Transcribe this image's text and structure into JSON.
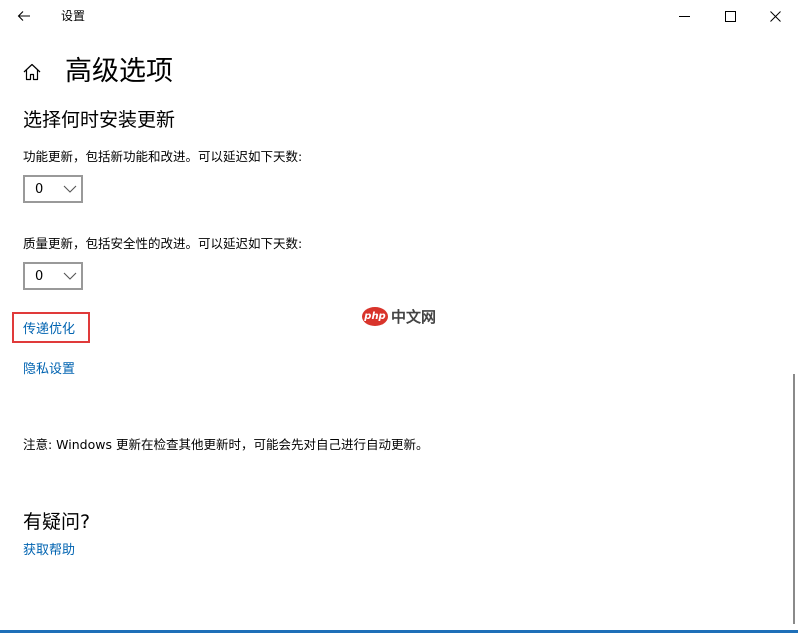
{
  "titlebar": {
    "app_title": "设置"
  },
  "header": {
    "title": "高级选项"
  },
  "install_section": {
    "title": "选择何时安装更新",
    "feature_updates": {
      "label": "功能更新，包括新功能和改进。可以延迟如下天数:",
      "value": "0"
    },
    "quality_updates": {
      "label": "质量更新，包括安全性的改进。可以延迟如下天数:",
      "value": "0"
    }
  },
  "links": {
    "delivery_optimization": "传递优化",
    "privacy_settings": "隐私设置"
  },
  "watermark": {
    "badge": "php",
    "text": "中文网"
  },
  "note": "注意: Windows 更新在检查其他更新时，可能会先对自己进行自动更新。",
  "help": {
    "title": "有疑问?",
    "link": "获取帮助"
  },
  "colors": {
    "link": "#0063b1",
    "highlight": "#e03a3a",
    "accent_line": "#1e6fb8"
  }
}
